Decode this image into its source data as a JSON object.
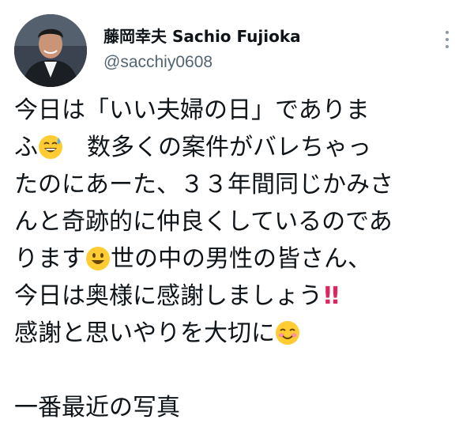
{
  "author": {
    "display_name": "藤岡幸夫 Sachio Fujioka",
    "handle": "@sacchiy0608"
  },
  "tweet": {
    "line1": "今日は「いい夫婦の日」でありま",
    "line2a": "ふ",
    "line2b": "　数多くの案件がバレちゃっ",
    "line3": "たのにあーた、３３年間同じかみさ",
    "line4": "んと奇跡的に仲良くしているのであ",
    "line5a": "ります",
    "line5b": "世の中の男性の皆さん、",
    "line6a": "今日は奥様に感謝しましょう",
    "line6b": "!!",
    "line7a": "感謝と思いやりを大切に",
    "line9": "一番最近の写真"
  },
  "icons": {
    "more": "more-vertical-icon",
    "emoji1": "grinning-sweat-emoji",
    "emoji2": "smiley-emoji",
    "emoji3": "smiling-blush-emoji"
  },
  "colors": {
    "text": "#0f1419",
    "secondary": "#536471",
    "emoji_yellow": "#ffcc33",
    "bangs": "#e0245e"
  }
}
